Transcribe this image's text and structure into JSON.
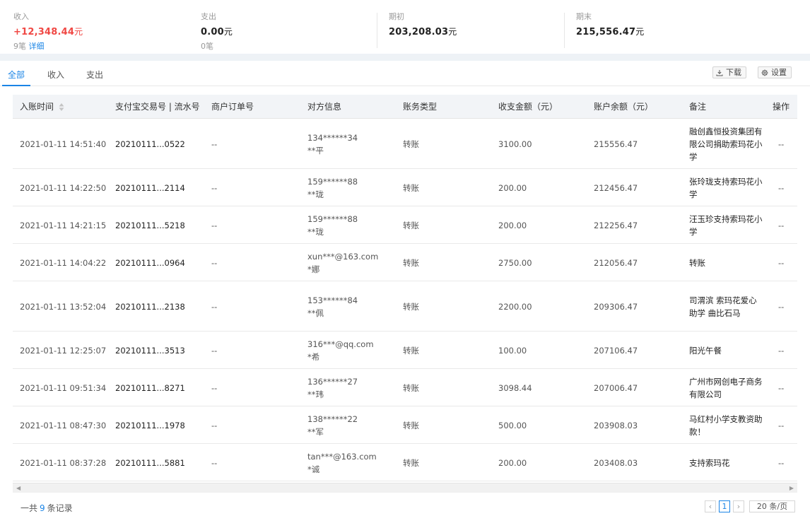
{
  "summary": {
    "income": {
      "label": "收入",
      "value": "+12,348.44",
      "unit": "元",
      "sub_count": "9笔",
      "sub_link": "详细"
    },
    "expense": {
      "label": "支出",
      "value": "0.00",
      "unit": "元",
      "sub_count": "0笔"
    },
    "opening": {
      "label": "期初",
      "value": "203,208.03",
      "unit": "元"
    },
    "closing": {
      "label": "期末",
      "value": "215,556.47",
      "unit": "元"
    }
  },
  "tabs": [
    "全部",
    "收入",
    "支出"
  ],
  "toolbar": {
    "download_label": "下载",
    "settings_label": "设置"
  },
  "table": {
    "headers": {
      "time": "入账时间",
      "trade_no": "支付宝交易号 | 流水号",
      "order_no": "商户订单号",
      "counterparty": "对方信息",
      "type": "账务类型",
      "amount": "收支金额（元）",
      "balance": "账户余额（元）",
      "note": "备注",
      "action": "操作"
    },
    "rows": [
      {
        "time": "2021-01-11 14:51:40",
        "trade_no": "20210111...0522",
        "order_no": "--",
        "cp1": "134******34",
        "cp2": "**平",
        "type": "转账",
        "amount": "3100.00",
        "balance": "215556.47",
        "note": "融创鑫恒投资集团有限公司捐助索玛花小学",
        "action": "--"
      },
      {
        "time": "2021-01-11 14:22:50",
        "trade_no": "20210111...2114",
        "order_no": "--",
        "cp1": "159******88",
        "cp2": "**珑",
        "type": "转账",
        "amount": "200.00",
        "balance": "212456.47",
        "note": "张玲珑支持索玛花小学",
        "action": "--"
      },
      {
        "time": "2021-01-11 14:21:15",
        "trade_no": "20210111...5218",
        "order_no": "--",
        "cp1": "159******88",
        "cp2": "**珑",
        "type": "转账",
        "amount": "200.00",
        "balance": "212256.47",
        "note": "汪玉珍支持索玛花小学",
        "action": "--"
      },
      {
        "time": "2021-01-11 14:04:22",
        "trade_no": "20210111...0964",
        "order_no": "--",
        "cp1": "xun***@163.com",
        "cp2": "*娜",
        "type": "转账",
        "amount": "2750.00",
        "balance": "212056.47",
        "note": "转账",
        "action": "--"
      },
      {
        "time": "2021-01-11 13:52:04",
        "trade_no": "20210111...2138",
        "order_no": "--",
        "cp1": "153******84",
        "cp2": "**佩",
        "type": "转账",
        "amount": "2200.00",
        "balance": "209306.47",
        "note": "司渭滨 索玛花爱心助学 曲比石马",
        "action": "--"
      },
      {
        "time": "2021-01-11 12:25:07",
        "trade_no": "20210111...3513",
        "order_no": "--",
        "cp1": "316***@qq.com",
        "cp2": "*希",
        "type": "转账",
        "amount": "100.00",
        "balance": "207106.47",
        "note": "阳光午餐",
        "action": "--"
      },
      {
        "time": "2021-01-11 09:51:34",
        "trade_no": "20210111...8271",
        "order_no": "--",
        "cp1": "136******27",
        "cp2": "**玮",
        "type": "转账",
        "amount": "3098.44",
        "balance": "207006.47",
        "note": "广州市网创电子商务有限公司",
        "action": "--"
      },
      {
        "time": "2021-01-11 08:47:30",
        "trade_no": "20210111...1978",
        "order_no": "--",
        "cp1": "138******22",
        "cp2": "**军",
        "type": "转账",
        "amount": "500.00",
        "balance": "203908.03",
        "note": "马红村小学支教资助款！",
        "action": "--"
      },
      {
        "time": "2021-01-11 08:37:28",
        "trade_no": "20210111...5881",
        "order_no": "--",
        "cp1": "tan***@163.com",
        "cp2": "*诚",
        "type": "转账",
        "amount": "200.00",
        "balance": "203408.03",
        "note": "支持索玛花",
        "action": "--"
      }
    ]
  },
  "footer": {
    "count_prefix": "一共",
    "count_value": "9",
    "count_suffix": "条记录",
    "current_page": "1",
    "page_size": "20 条/页"
  }
}
